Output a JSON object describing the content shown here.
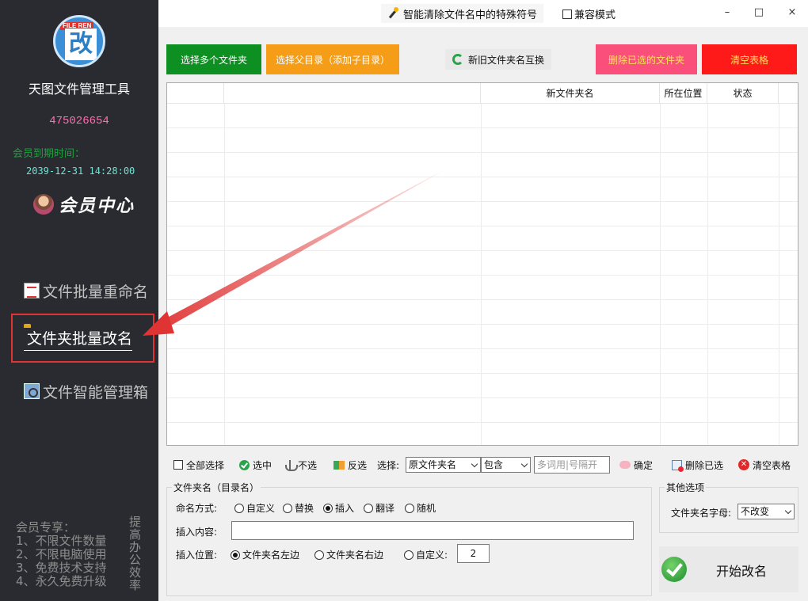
{
  "sidebar": {
    "logo_ribbon": "FILE REN",
    "logo_glyph": "改",
    "app_title": "天图文件管理工具",
    "qq": "475026654",
    "expire_label": "会员到期时间：",
    "expire_date": "2039-12-31 14:28:00",
    "member_center": "会员中心",
    "nav": {
      "batch_rename_files": "文件批量重命名",
      "batch_rename_folders": "文件夹批量改名",
      "smart_manager": "文件智能管理箱"
    },
    "perks": [
      "会员专享：",
      "1、不限文件数量",
      "2、不限电脑使用",
      "3、免费技术支持",
      "4、永久免费升级"
    ],
    "slogan": "提高办公效率"
  },
  "topbar": {
    "feature_link": "智能清除文件名中的特殊符号",
    "compat_mode": "兼容模式",
    "minimize": "–",
    "maximize": "□",
    "close": "×"
  },
  "actions": {
    "select_folders": "选择多个文件夹",
    "select_parent": "选择父目录（添加子目录）",
    "swap_names": "新旧文件夹名互换",
    "delete_selected": "删除已选的文件夹",
    "clear_table": "清空表格"
  },
  "table": {
    "columns": [
      "",
      "",
      "新文件夹名",
      "所在位置",
      "状态"
    ]
  },
  "filter": {
    "select_all": "全部选择",
    "check": "选中",
    "uncheck": "不选",
    "invert": "反选",
    "select_label": "选择:",
    "field_select": "原文件夹名",
    "match_select": "包含",
    "keyword_placeholder": "多词用|号隔开",
    "confirm": "确定",
    "delete_selected": "删除已选",
    "clear_table": "清空表格"
  },
  "naming_group": {
    "title": "文件夹名（目录名）",
    "mode_label": "命名方式:",
    "modes": [
      "自定义",
      "替换",
      "插入",
      "翻译",
      "随机"
    ],
    "selected_mode": "插入",
    "insert_label": "插入内容:",
    "insert_value": "",
    "position_label": "插入位置:",
    "positions": [
      "文件夹名左边",
      "文件夹名右边",
      "自定义:"
    ],
    "custom_position": "2"
  },
  "other_group": {
    "title": "其他选项",
    "case_label": "文件夹名字母:",
    "case_value": "不改变"
  },
  "start": {
    "label": "开始改名"
  },
  "colors": {
    "sidebar_bg": "#2a2b30",
    "green": "#0d8f21",
    "orange": "#f59d16",
    "pink": "#fb4f7b",
    "red": "#ff1a1a",
    "annotation": "#e03434"
  }
}
